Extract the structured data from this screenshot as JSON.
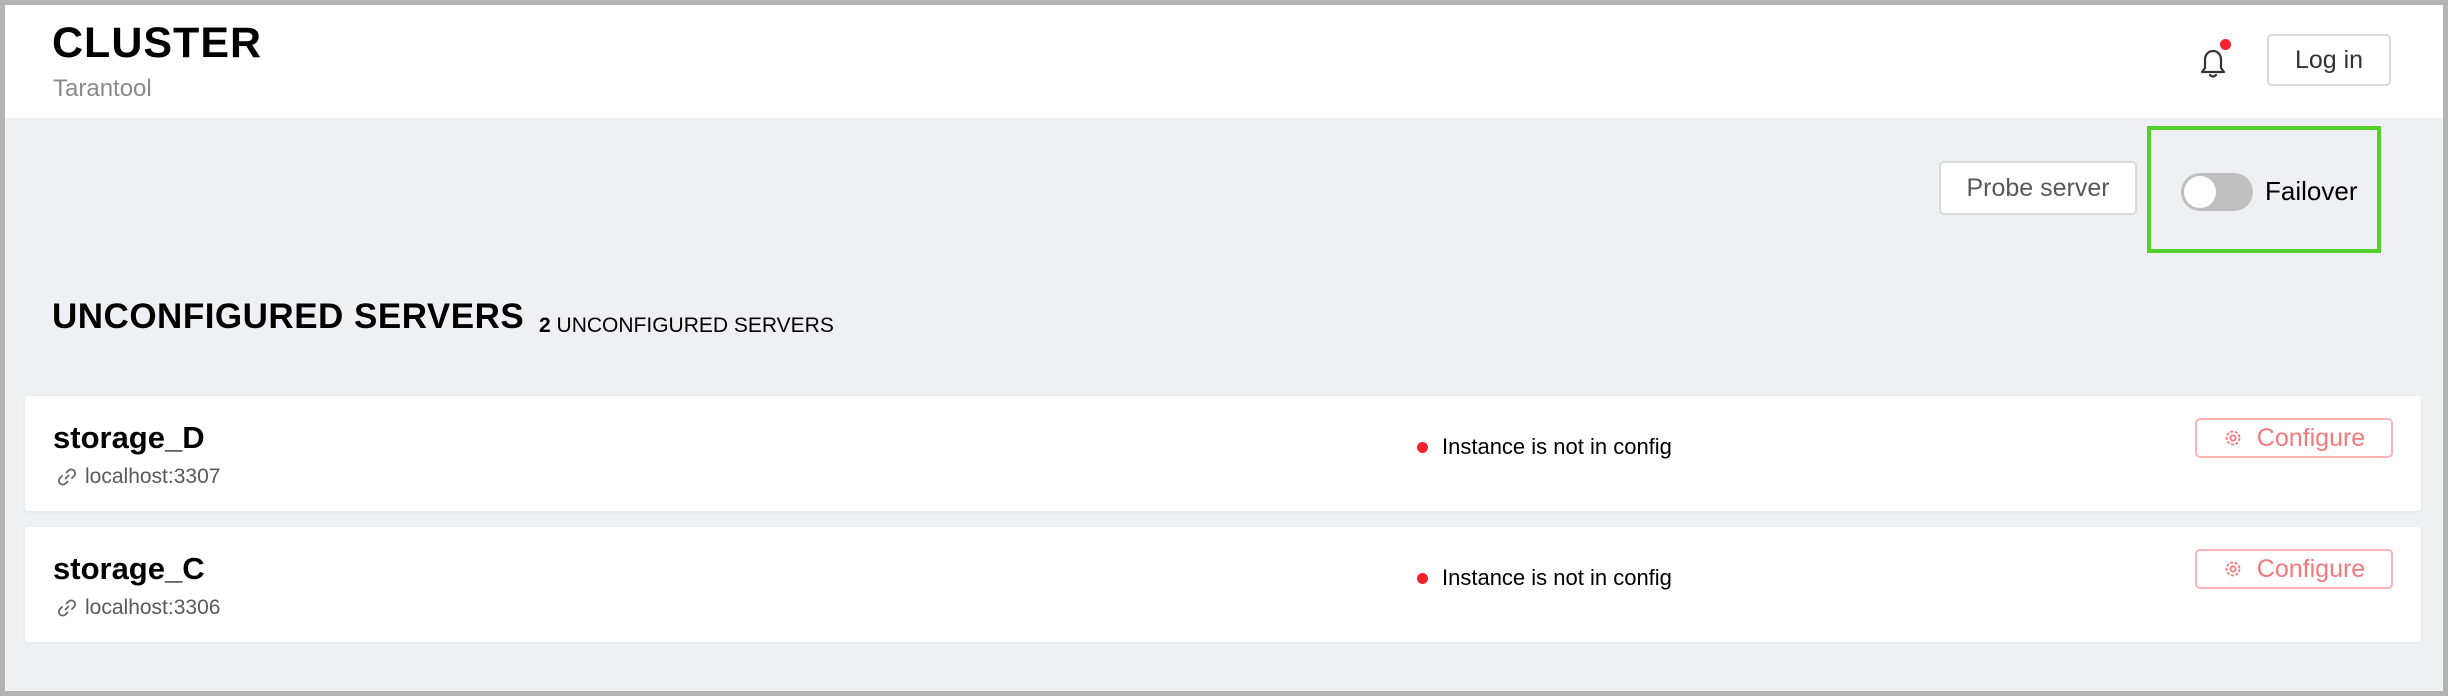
{
  "header": {
    "title": "CLUSTER",
    "subtitle": "Tarantool",
    "login_label": "Log in",
    "notification_icon": "bell-icon",
    "notification_dot_color": "#f5222d"
  },
  "toolbar": {
    "probe_label": "Probe server",
    "failover_label": "Failover",
    "failover_enabled": false,
    "highlight_color": "#52d12a"
  },
  "section": {
    "title": "UNCONFIGURED SERVERS",
    "count": "2",
    "count_label": "UNCONFIGURED SERVERS"
  },
  "servers": [
    {
      "name": "storage_D",
      "uri": "localhost:3307",
      "status": "Instance is not in config",
      "status_color": "#f5222d",
      "action_label": "Configure"
    },
    {
      "name": "storage_C",
      "uri": "localhost:3306",
      "status": "Instance is not in config",
      "status_color": "#f5222d",
      "action_label": "Configure"
    }
  ],
  "colors": {
    "background": "#eff0f4",
    "configure_accent": "#f5797c"
  }
}
